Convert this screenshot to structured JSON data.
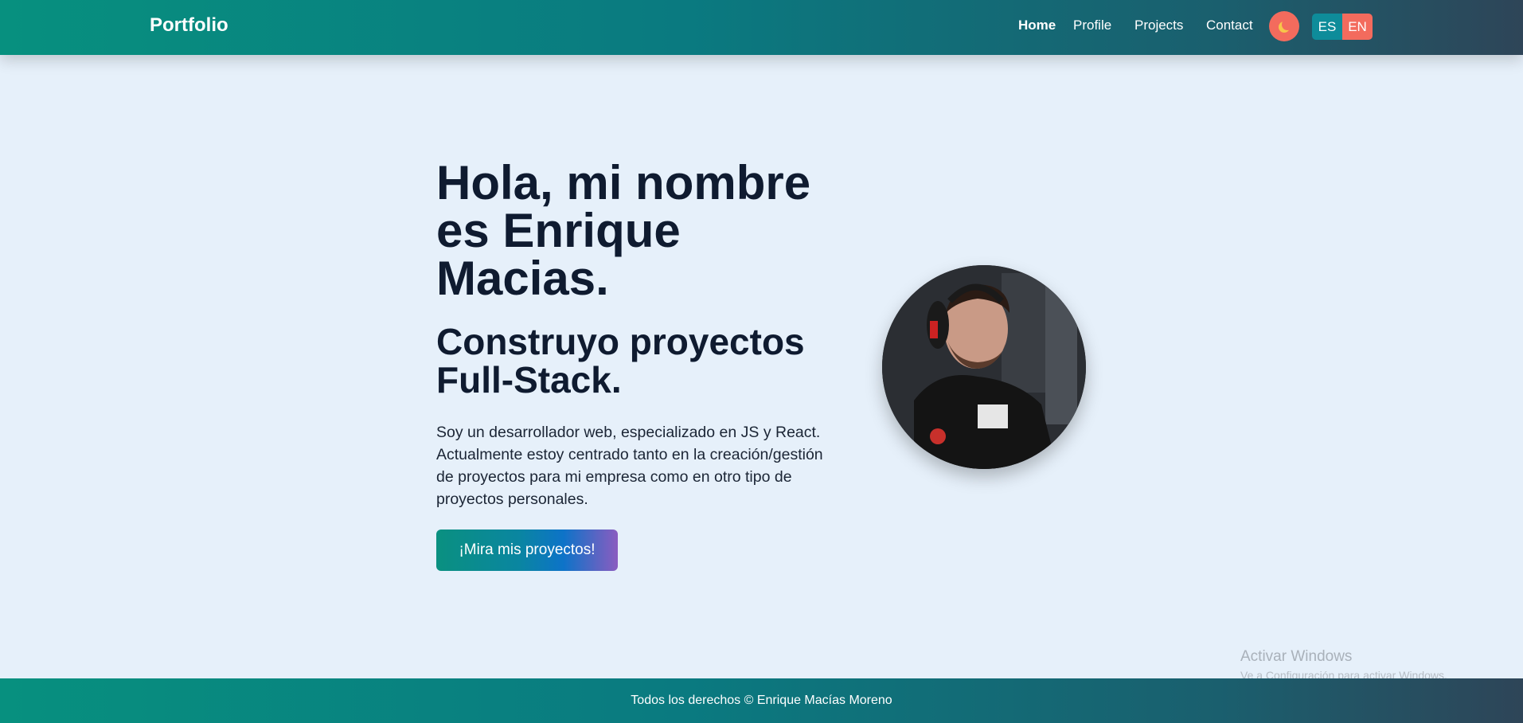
{
  "navbar": {
    "brand": "Portfolio",
    "links": [
      {
        "label": "Home",
        "active": true
      },
      {
        "label": "Profile"
      },
      {
        "label": "Projects"
      },
      {
        "label": "Contact"
      }
    ],
    "theme_toggle_icon": "moon-icon",
    "languages": [
      "ES",
      "EN"
    ]
  },
  "hero": {
    "title": "Hola, mi nombre es Enrique Macias.",
    "subtitle": "Construyo proyectos Full-Stack.",
    "description": "Soy un desarrollador web, especializado en JS y React. Actualmente estoy centrado tanto en la creación/gestión de proyectos para mi empresa como en otro tipo de proyectos personales.",
    "cta_label": "¡Mira mis proyectos!"
  },
  "watermark": {
    "title": "Activar Windows",
    "subtitle": "Ve a Configuración para activar Windows."
  },
  "footer": {
    "text": "Todos los derechos © Enrique Macías Moreno"
  },
  "colors": {
    "accent": "#07907f",
    "accent_dark": "#2e4558",
    "toggle": "#f36b5d",
    "background": "#e6f0fa",
    "text": "#0f1b30"
  }
}
